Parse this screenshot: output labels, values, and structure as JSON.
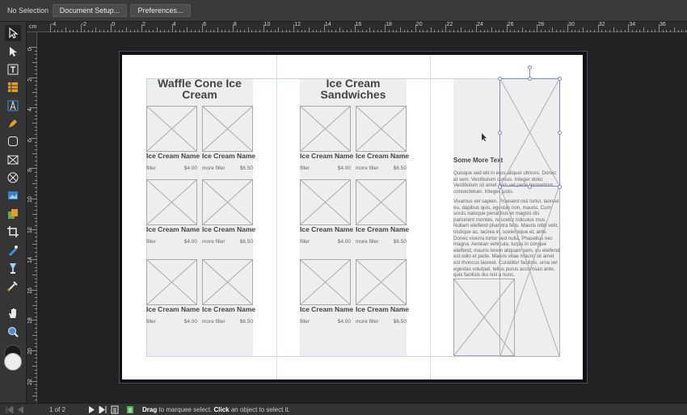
{
  "topbar": {
    "selection_label": "No Selection",
    "document_setup": "Document Setup...",
    "preferences": "Preferences..."
  },
  "toolbar": {
    "tools": [
      "move-tool",
      "node-tool",
      "frame-text-tool",
      "table-tool",
      "artistic-text-tool",
      "pen-tool",
      "rounded-rectangle-tool",
      "picture-frame-rectangle-tool",
      "picture-frame-ellipse-tool",
      "place-image-tool",
      "color-picker-tool",
      "crop-tool",
      "fill-tool",
      "transparency-tool",
      "eyedropper-tool",
      "hand-tool",
      "zoom-tool"
    ],
    "fill_color": "#1a1a1a",
    "stroke_color": "#eeeeee"
  },
  "ruler": {
    "unit": "cm",
    "h_labels": [
      "-4",
      "-2",
      "0",
      "2",
      "4",
      "6",
      "8",
      "10",
      "12",
      "14",
      "16",
      "18",
      "20",
      "22",
      "24",
      "26",
      "28",
      "30",
      "32",
      "34",
      "36"
    ],
    "v_labels": [
      "0",
      "2",
      "4",
      "6",
      "8",
      "10",
      "12",
      "14",
      "16",
      "18",
      "20",
      "22"
    ]
  },
  "document": {
    "panels": [
      {
        "heading_lines": [
          "Waffle Cone Ice",
          "Cream"
        ]
      },
      {
        "heading_lines": [
          "Ice Cream",
          "Sandwiches"
        ]
      }
    ],
    "item": {
      "name": "Ice Cream Name",
      "desc1": "filler",
      "desc2": "more filler",
      "price1": "$4.00",
      "price2": "$6.50"
    },
    "side": {
      "heading": "Some More Text",
      "para1": "Quisque sed elit in eros aliquet ultrices. Donec at sem. Vestibulum cursus. Integer dolor. Vestibulum sit amet sem vel pede fermentum consectetuer. Integer justo.",
      "para2": "Vivamus vel sapien. Praesent nisl tortor, laoreet eu, dapibus quis, egestas non, mauris. Cum sociis natoque penatibus et magnis dis parturient montes, nascetur ridiculus mus. Nullam eleifend pharetra felis. Mauris nibh velit, tristique ac, lacinia in, scelerisque et, ante. Donec viverra tortor sed nulla. Phasellus nec magna. Aenean vehicula, turpis in congue eleifend, mauris lorem aliquam sem, eu eleifend est odio et pede. Mauris vitae mauris sit amet est rhoncus laoreet. Curabitur facilisis, urna vel egestas volutpat, tellus purus accumsan ante, quis facilisis dui nisl a nunc."
    }
  },
  "statusbar": {
    "page_indicator": "1 of 2",
    "hint_drag": "Drag",
    "hint_mid": " to marquee select. ",
    "hint_click": "Click",
    "hint_end": " an object to select it."
  }
}
